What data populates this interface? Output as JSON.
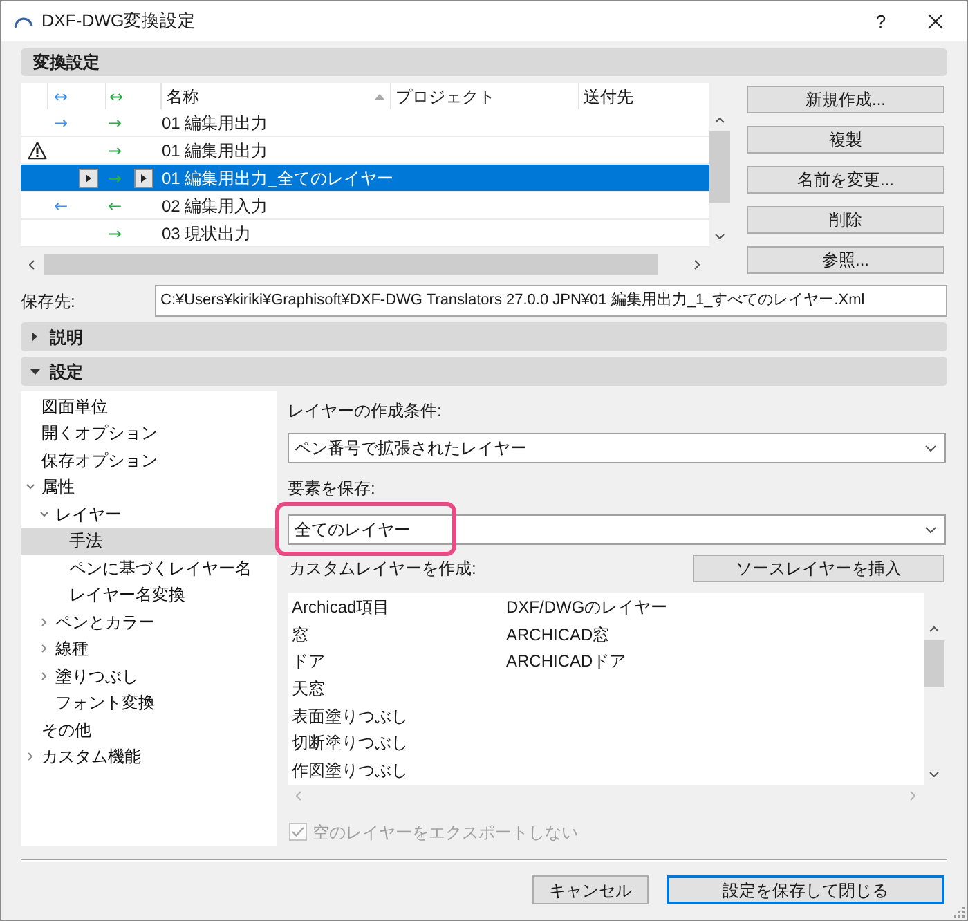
{
  "window": {
    "title": "DXF-DWG変換設定",
    "help": "?"
  },
  "conversion": {
    "title": "変換設定",
    "columns": [
      {
        "kind": "symbol",
        "symbol": "↔",
        "color": "#3c8fe6"
      },
      {
        "kind": "symbol",
        "symbol": "↔",
        "color": "#2eaa4a"
      },
      {
        "kind": "text",
        "label": "名称",
        "sorted": true
      },
      {
        "kind": "text",
        "label": "プロジェクト",
        "sorted": false
      },
      {
        "kind": "text",
        "label": "送付先",
        "sorted": false
      }
    ],
    "rows": [
      {
        "warning": false,
        "symbol_1": "→",
        "symbol_2": "→",
        "name": "01 編集用出力",
        "selected": false
      },
      {
        "warning": true,
        "symbol_2": "→",
        "name": "01 編集用出力",
        "selected": false
      },
      {
        "warning": false,
        "symbol_2": "→",
        "name": "01 編集用出力_全てのレイヤー",
        "selected": true
      },
      {
        "warning": false,
        "symbol_1": "←",
        "symbol_2": "←",
        "name": "02 編集用入力",
        "selected": false
      },
      {
        "warning": false,
        "symbol_2": "→",
        "name": "03 現状出力",
        "selected": false
      }
    ],
    "buttons": [
      "新規作成...",
      "複製",
      "名前を変更...",
      "削除",
      "参照..."
    ]
  },
  "save_path": {
    "label": "保存先:",
    "value": "C:¥Users¥kiriki¥Graphisoft¥DXF-DWG Translators 27.0.0 JPN¥01 編集用出力_1_すべてのレイヤー.Xml"
  },
  "description": {
    "title": "説明",
    "expanded": false
  },
  "settings": {
    "title": "設定",
    "expanded": true,
    "tree": [
      {
        "label": "図面単位",
        "selected": false
      },
      {
        "label": "開くオプション",
        "selected": false
      },
      {
        "label": "保存オプション",
        "selected": false
      },
      {
        "label": "属性",
        "selected": false,
        "expanded": true,
        "children": [
          {
            "label": "レイヤー",
            "selected": false,
            "expanded": true,
            "children": [
              {
                "label": "手法",
                "selected": true
              },
              {
                "label": "ペンに基づくレイヤー名",
                "selected": false
              },
              {
                "label": "レイヤー名変換",
                "selected": false
              }
            ]
          },
          {
            "label": "ペンとカラー",
            "selected": false,
            "expanded": false
          },
          {
            "label": "線種",
            "selected": false,
            "expanded": false
          },
          {
            "label": "塗りつぶし",
            "selected": false,
            "expanded": false
          },
          {
            "label": "フォント変換",
            "selected": false
          }
        ]
      },
      {
        "label": "その他",
        "selected": false
      },
      {
        "label": "カスタム機能",
        "selected": false,
        "expanded": false
      }
    ],
    "layer_condition": {
      "label": "レイヤーの作成条件:",
      "value": "ペン番号で拡張されたレイヤー"
    },
    "save_elements": {
      "label": "要素を保存:",
      "value": "全てのレイヤー",
      "highlighted": true
    },
    "custom_layers": {
      "label": "カスタムレイヤーを作成:",
      "button": "ソースレイヤーを挿入",
      "columns": [
        "Archicad項目",
        "DXF/DWGのレイヤー"
      ],
      "rows": [
        {
          "item": "窓",
          "layer": "ARCHICAD窓"
        },
        {
          "item": "ドア",
          "layer": "ARCHICADドア"
        },
        {
          "item": "天窓"
        },
        {
          "item": "表面塗りつぶし"
        },
        {
          "item": "切断塗りつぶし"
        },
        {
          "item": "作図塗りつぶし"
        }
      ]
    },
    "export_empty": {
      "label": "空のレイヤーをエクスポートしない",
      "checked": true,
      "disabled": true
    }
  },
  "footer_buttons": [
    {
      "label": "キャンセル",
      "default": false
    },
    {
      "label": "設定を保存して閉じる",
      "default": true
    }
  ]
}
